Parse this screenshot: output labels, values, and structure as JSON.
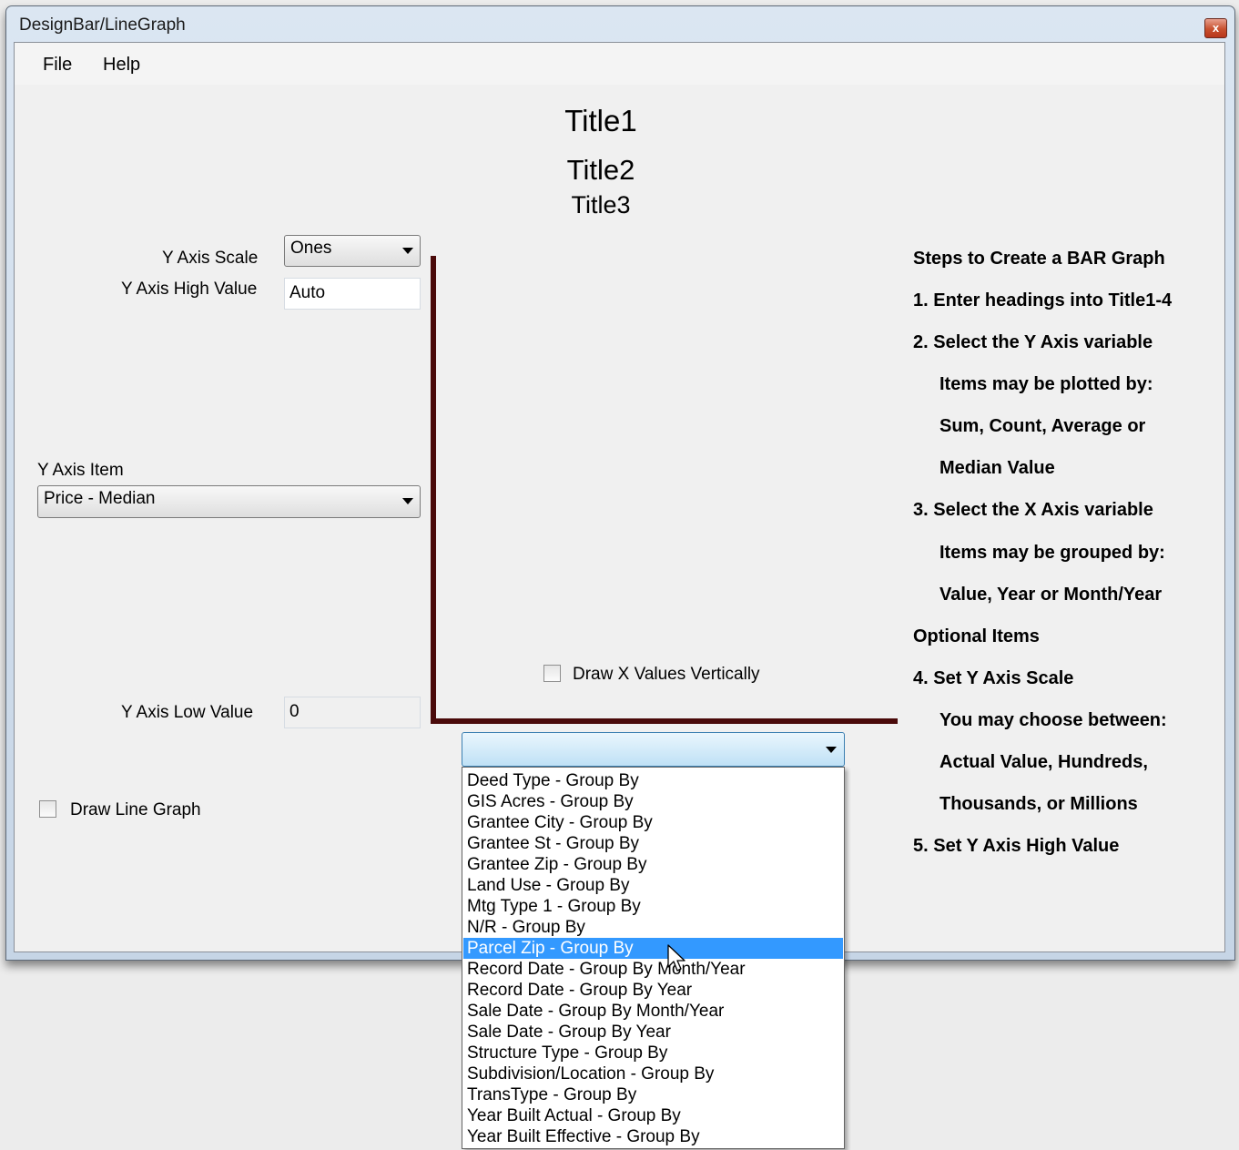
{
  "window": {
    "title": "DesignBar/LineGraph",
    "close_glyph": "x"
  },
  "menu": {
    "file": "File",
    "help": "Help"
  },
  "titles": {
    "title1": "Title1",
    "title2": "Title2",
    "title3": "Title3"
  },
  "y_axis_scale": {
    "label": "Y Axis Scale",
    "value": "Ones"
  },
  "y_axis_high": {
    "label": "Y Axis High Value",
    "value": "Auto"
  },
  "y_axis_item": {
    "label": "Y Axis Item",
    "value": "Price - Median"
  },
  "y_axis_low": {
    "label": "Y Axis Low Value",
    "value": "0"
  },
  "draw_x_vertical": {
    "label": "Draw X Values Vertically",
    "checked": false
  },
  "draw_line_graph": {
    "label": "Draw Line Graph",
    "checked": false
  },
  "x_axis_combo": {
    "value": ""
  },
  "x_axis_options": [
    "Deed Type - Group By",
    "GIS Acres - Group By",
    "Grantee City - Group By",
    "Grantee St - Group By",
    "Grantee Zip - Group By",
    "Land Use - Group By",
    "Mtg Type 1 - Group By",
    "N/R - Group By",
    "Parcel Zip - Group By",
    "Record Date - Group By Month/Year",
    "Record Date - Group By Year",
    "Sale Date - Group By Month/Year",
    "Sale Date - Group By Year",
    "Structure Type - Group By",
    "Subdivision/Location - Group By",
    "TransType - Group By",
    "Year Built Actual - Group By",
    "Year Built Effective - Group By"
  ],
  "x_axis_selected": "Parcel Zip - Group By",
  "steps": [
    "Steps to Create a BAR Graph",
    "1.  Enter headings into Title1-4",
    "2.  Select the Y Axis variable",
    "Items may be plotted by:",
    "Sum, Count, Average or",
    "Median Value",
    "3.  Select the X Axis variable",
    "Items may be grouped by:",
    "Value, Year or Month/Year",
    "Optional Items",
    "4.  Set Y Axis Scale",
    "You may choose between:",
    "Actual Value, Hundreds,",
    "Thousands, or Millions",
    "5.  Set Y Axis High Value"
  ],
  "colors": {
    "axis": "#4a0a0a",
    "selection": "#3399ff"
  }
}
